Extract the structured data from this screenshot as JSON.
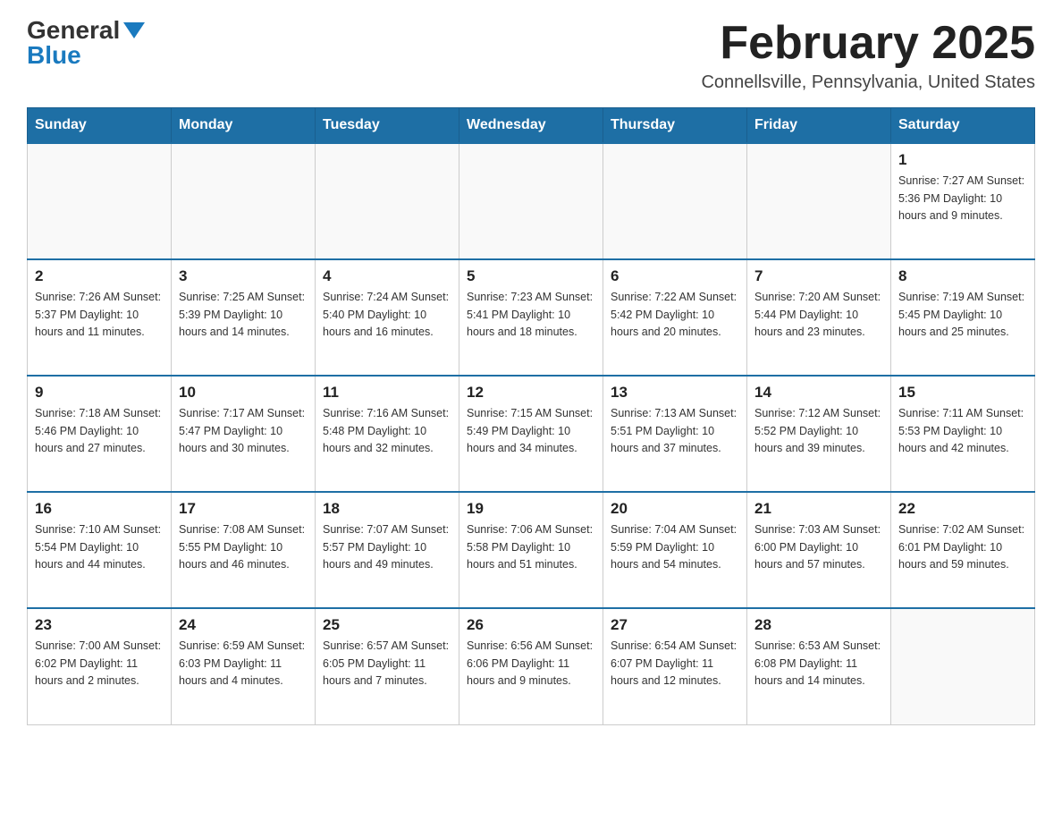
{
  "logo": {
    "general": "General",
    "blue": "Blue"
  },
  "title": "February 2025",
  "subtitle": "Connellsville, Pennsylvania, United States",
  "days_of_week": [
    "Sunday",
    "Monday",
    "Tuesday",
    "Wednesday",
    "Thursday",
    "Friday",
    "Saturday"
  ],
  "weeks": [
    [
      {
        "day": "",
        "info": ""
      },
      {
        "day": "",
        "info": ""
      },
      {
        "day": "",
        "info": ""
      },
      {
        "day": "",
        "info": ""
      },
      {
        "day": "",
        "info": ""
      },
      {
        "day": "",
        "info": ""
      },
      {
        "day": "1",
        "info": "Sunrise: 7:27 AM\nSunset: 5:36 PM\nDaylight: 10 hours and 9 minutes."
      }
    ],
    [
      {
        "day": "2",
        "info": "Sunrise: 7:26 AM\nSunset: 5:37 PM\nDaylight: 10 hours and 11 minutes."
      },
      {
        "day": "3",
        "info": "Sunrise: 7:25 AM\nSunset: 5:39 PM\nDaylight: 10 hours and 14 minutes."
      },
      {
        "day": "4",
        "info": "Sunrise: 7:24 AM\nSunset: 5:40 PM\nDaylight: 10 hours and 16 minutes."
      },
      {
        "day": "5",
        "info": "Sunrise: 7:23 AM\nSunset: 5:41 PM\nDaylight: 10 hours and 18 minutes."
      },
      {
        "day": "6",
        "info": "Sunrise: 7:22 AM\nSunset: 5:42 PM\nDaylight: 10 hours and 20 minutes."
      },
      {
        "day": "7",
        "info": "Sunrise: 7:20 AM\nSunset: 5:44 PM\nDaylight: 10 hours and 23 minutes."
      },
      {
        "day": "8",
        "info": "Sunrise: 7:19 AM\nSunset: 5:45 PM\nDaylight: 10 hours and 25 minutes."
      }
    ],
    [
      {
        "day": "9",
        "info": "Sunrise: 7:18 AM\nSunset: 5:46 PM\nDaylight: 10 hours and 27 minutes."
      },
      {
        "day": "10",
        "info": "Sunrise: 7:17 AM\nSunset: 5:47 PM\nDaylight: 10 hours and 30 minutes."
      },
      {
        "day": "11",
        "info": "Sunrise: 7:16 AM\nSunset: 5:48 PM\nDaylight: 10 hours and 32 minutes."
      },
      {
        "day": "12",
        "info": "Sunrise: 7:15 AM\nSunset: 5:49 PM\nDaylight: 10 hours and 34 minutes."
      },
      {
        "day": "13",
        "info": "Sunrise: 7:13 AM\nSunset: 5:51 PM\nDaylight: 10 hours and 37 minutes."
      },
      {
        "day": "14",
        "info": "Sunrise: 7:12 AM\nSunset: 5:52 PM\nDaylight: 10 hours and 39 minutes."
      },
      {
        "day": "15",
        "info": "Sunrise: 7:11 AM\nSunset: 5:53 PM\nDaylight: 10 hours and 42 minutes."
      }
    ],
    [
      {
        "day": "16",
        "info": "Sunrise: 7:10 AM\nSunset: 5:54 PM\nDaylight: 10 hours and 44 minutes."
      },
      {
        "day": "17",
        "info": "Sunrise: 7:08 AM\nSunset: 5:55 PM\nDaylight: 10 hours and 46 minutes."
      },
      {
        "day": "18",
        "info": "Sunrise: 7:07 AM\nSunset: 5:57 PM\nDaylight: 10 hours and 49 minutes."
      },
      {
        "day": "19",
        "info": "Sunrise: 7:06 AM\nSunset: 5:58 PM\nDaylight: 10 hours and 51 minutes."
      },
      {
        "day": "20",
        "info": "Sunrise: 7:04 AM\nSunset: 5:59 PM\nDaylight: 10 hours and 54 minutes."
      },
      {
        "day": "21",
        "info": "Sunrise: 7:03 AM\nSunset: 6:00 PM\nDaylight: 10 hours and 57 minutes."
      },
      {
        "day": "22",
        "info": "Sunrise: 7:02 AM\nSunset: 6:01 PM\nDaylight: 10 hours and 59 minutes."
      }
    ],
    [
      {
        "day": "23",
        "info": "Sunrise: 7:00 AM\nSunset: 6:02 PM\nDaylight: 11 hours and 2 minutes."
      },
      {
        "day": "24",
        "info": "Sunrise: 6:59 AM\nSunset: 6:03 PM\nDaylight: 11 hours and 4 minutes."
      },
      {
        "day": "25",
        "info": "Sunrise: 6:57 AM\nSunset: 6:05 PM\nDaylight: 11 hours and 7 minutes."
      },
      {
        "day": "26",
        "info": "Sunrise: 6:56 AM\nSunset: 6:06 PM\nDaylight: 11 hours and 9 minutes."
      },
      {
        "day": "27",
        "info": "Sunrise: 6:54 AM\nSunset: 6:07 PM\nDaylight: 11 hours and 12 minutes."
      },
      {
        "day": "28",
        "info": "Sunrise: 6:53 AM\nSunset: 6:08 PM\nDaylight: 11 hours and 14 minutes."
      },
      {
        "day": "",
        "info": ""
      }
    ]
  ]
}
